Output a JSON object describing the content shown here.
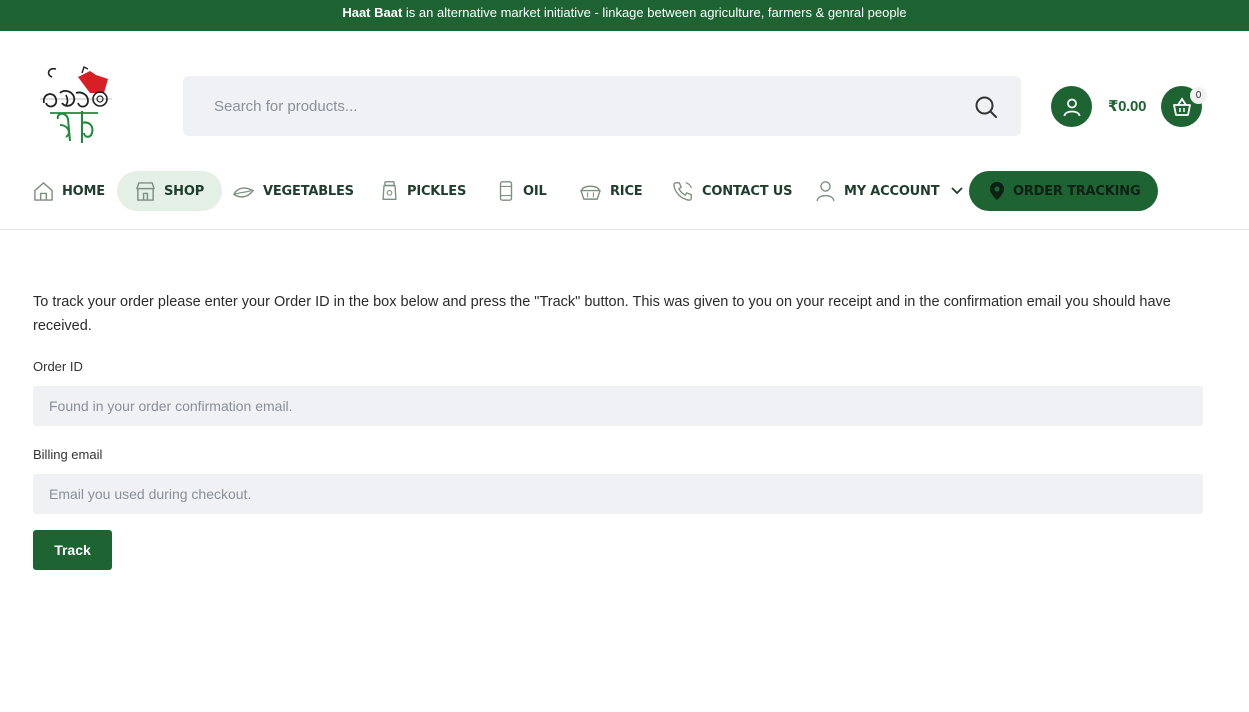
{
  "topbar": {
    "brand": "Haat Baat",
    "text": " is an alternative market initiative - linkage between agriculture, farmers & genral people"
  },
  "header": {
    "search_placeholder": "Search for products...",
    "cart_total": "₹0.00",
    "cart_count": "0"
  },
  "nav": {
    "items": [
      {
        "label": "HOME",
        "icon": "home-icon"
      },
      {
        "label": "SHOP",
        "icon": "store-icon"
      },
      {
        "label": "VEGETABLES",
        "icon": "leaf-icon"
      },
      {
        "label": "PICKLES",
        "icon": "jar-icon"
      },
      {
        "label": "OIL",
        "icon": "bottle-icon"
      },
      {
        "label": "RICE",
        "icon": "rice-bowl-icon"
      },
      {
        "label": "CONTACT US",
        "icon": "phone-icon"
      },
      {
        "label": "MY ACCOUNT",
        "icon": "user-icon"
      },
      {
        "label": "ORDER TRACKING",
        "icon": "location-pin-icon"
      }
    ]
  },
  "main": {
    "intro": "To track your order please enter your Order ID in the box below and press the \"Track\" button. This was given to you on your receipt and in the confirmation email you should have received.",
    "order_id_label": "Order ID",
    "order_id_placeholder": "Found in your order confirmation email.",
    "billing_email_label": "Billing email",
    "billing_email_placeholder": "Email you used during checkout.",
    "track_button": "Track"
  },
  "colors": {
    "brand_green": "#1e6433",
    "field_bg": "#eff1f5",
    "active_nav_bg": "#e4efe6"
  }
}
